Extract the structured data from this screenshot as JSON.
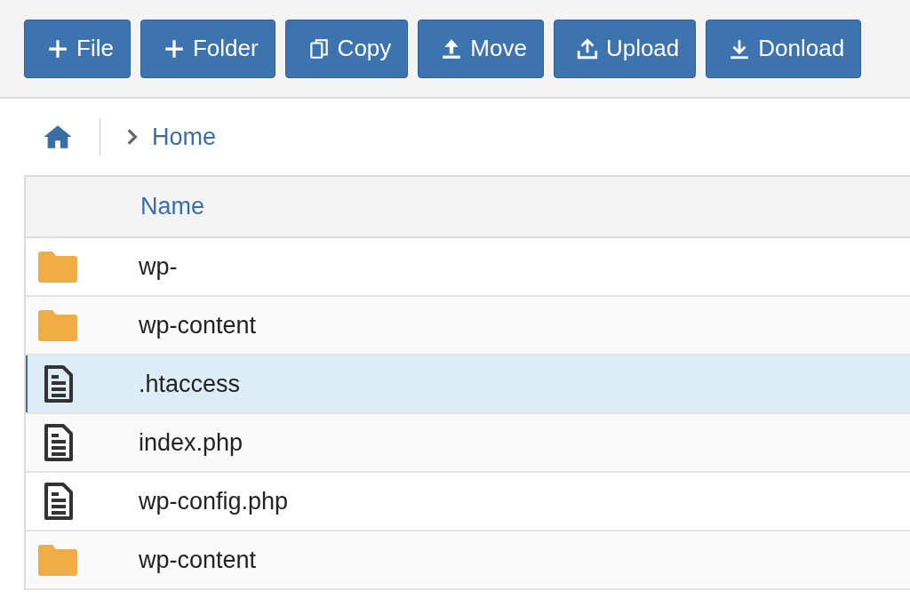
{
  "toolbar": [
    {
      "kind": "plus",
      "label": "File"
    },
    {
      "kind": "plus",
      "label": "Folder"
    },
    {
      "kind": "copy",
      "label": "Copy"
    },
    {
      "kind": "move",
      "label": "Move"
    },
    {
      "kind": "upload",
      "label": "Upload"
    },
    {
      "kind": "download",
      "label": "Donload"
    }
  ],
  "breadcrumb": {
    "items": [
      "Home"
    ]
  },
  "table": {
    "columns": [
      "Name"
    ],
    "rows": [
      {
        "kind": "folder",
        "name": "wp-",
        "selected": false
      },
      {
        "kind": "folder",
        "name": "wp-content",
        "selected": false
      },
      {
        "kind": "file",
        "name": ".htaccess",
        "selected": true
      },
      {
        "kind": "file",
        "name": "index.php",
        "selected": false
      },
      {
        "kind": "file",
        "name": "wp-config.php",
        "selected": false
      },
      {
        "kind": "folder",
        "name": "wp-content",
        "selected": false
      }
    ]
  }
}
